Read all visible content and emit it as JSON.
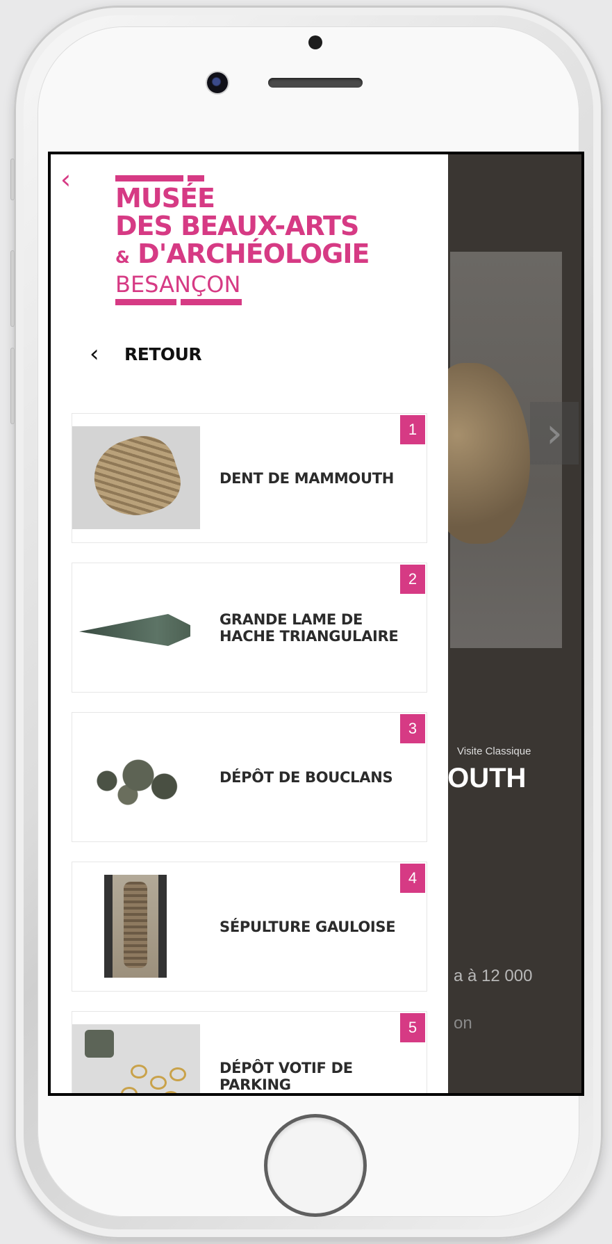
{
  "app": {
    "logo": {
      "line1": "MUSÉE",
      "line2": "DES BEAUX-ARTS",
      "line3_amp": "&",
      "line3": "D'ARCHÉOLOGIE",
      "line4": "BESANÇON"
    },
    "back_label": "RETOUR",
    "accent_color": "#d63a84"
  },
  "items": [
    {
      "number": "1",
      "title": "DENT DE MAMMOUTH"
    },
    {
      "number": "2",
      "title": "GRANDE LAME DE HACHE TRIANGULAIRE"
    },
    {
      "number": "3",
      "title": "DÉPÔT DE BOUCLANS"
    },
    {
      "number": "4",
      "title": "SÉPULTURE GAULOISE"
    },
    {
      "number": "5",
      "title": "DÉPÔT VOTIF DE PARKING"
    }
  ],
  "background": {
    "subtitle": "Visite Classique",
    "title_fragment": "IOUTH",
    "line1": "a à 12 000",
    "line2": "on"
  }
}
